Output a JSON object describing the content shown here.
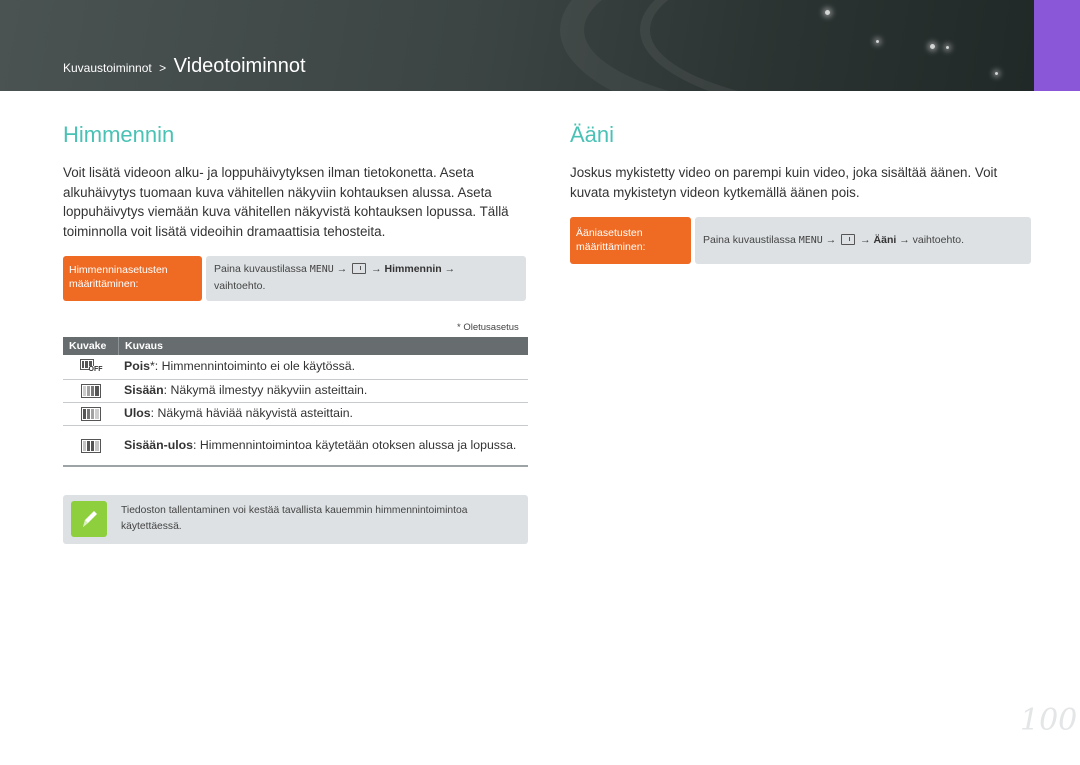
{
  "header": {
    "breadcrumb_parent": "Kuvaustoiminnot",
    "breadcrumb_separator": ">",
    "breadcrumb_current": "Videotoiminnot",
    "accent_color": "#8b57d9"
  },
  "left": {
    "title": "Himmennin",
    "paragraph": "Voit lisätä videoon alku- ja loppuhäivytyksen ilman tietokonetta. Aseta alkuhäivytys tuomaan kuva vähitellen näkyviin kohtauksen alussa. Aseta loppuhäivytys viemään kuva vähitellen näkyvistä kohtauksen lopussa. Tällä toiminnolla voit lisätä videoihin dramaattisia tehosteita.",
    "setting": {
      "label_line1": "Himmenninasetusten",
      "label_line2": "määrittäminen:",
      "desc_prefix": "Paina kuvaustilassa",
      "menu_key": "MENU",
      "arrow1": "→",
      "arrow2": "→",
      "option": "Himmennin",
      "arrow3": "→",
      "desc_suffix": "vaihtoehto."
    },
    "footnote": "* Oletusasetus",
    "table": {
      "header_icon": "Kuvake",
      "header_desc": "Kuvaus",
      "rows": [
        {
          "icon": "fade-off-icon",
          "icon_text": "OFF",
          "term": "Pois",
          "marker": "*",
          "desc": ": Himmennintoiminto ei ole käytössä."
        },
        {
          "icon": "fade-in-icon",
          "term": "Sisään",
          "desc": ": Näkymä ilmestyy näkyviin asteittain."
        },
        {
          "icon": "fade-out-icon",
          "term": "Ulos",
          "desc": ": Näkymä häviää näkyvistä asteittain."
        },
        {
          "icon": "fade-in-out-icon",
          "term": "Sisään-ulos",
          "desc": ": Himmennintoimintoa käytetään otoksen alussa ja lopussa."
        }
      ]
    },
    "note": {
      "icon": "pen-note-icon",
      "text": "Tiedoston tallentaminen voi kestää tavallista kauemmin himmennintoimintoa käytettäessä."
    }
  },
  "right": {
    "title": "Ääni",
    "paragraph": "Joskus mykistetty video on parempi kuin video, joka sisältää äänen. Voit kuvata mykistetyn videon kytkemällä äänen pois.",
    "setting": {
      "label_line1": "Ääniasetusten",
      "label_line2": "määrittäminen:",
      "desc_prefix": "Paina kuvaustilassa",
      "menu_key": "MENU",
      "arrow1": "→",
      "arrow2": "→",
      "option": "Ääni",
      "arrow3": "→",
      "desc_suffix": "vaihtoehto."
    }
  },
  "page_number": "100",
  "colors": {
    "title": "#49c2b5",
    "setting_label": "#ef6b24",
    "note_icon": "#8ecf3d"
  }
}
